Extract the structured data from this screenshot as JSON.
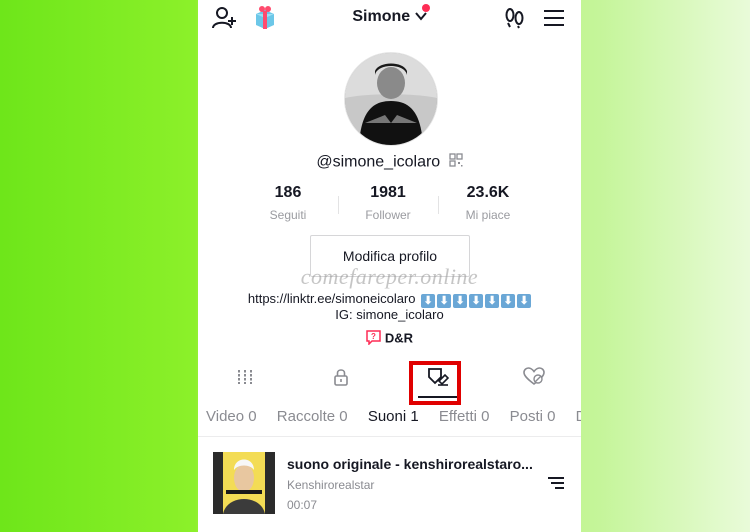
{
  "header": {
    "title": "Simone",
    "icons": [
      "add-user-icon",
      "gift-icon",
      "footprints-icon",
      "menu-icon"
    ],
    "notification_color": "#fe2c55"
  },
  "profile": {
    "username": "@simone_icolaro",
    "stats": [
      {
        "value": "186",
        "label": "Seguiti"
      },
      {
        "value": "1981",
        "label": "Follower"
      },
      {
        "value": "23.6K",
        "label": "Mi piace"
      }
    ],
    "edit_label": "Modifica profilo",
    "bio_link": "https://linktr.ee/simoneicolaro",
    "bio_arrows": [
      "⬇",
      "⬇",
      "⬇",
      "⬇",
      "⬇",
      "⬇",
      "⬇"
    ],
    "bio_ig": "IG: simone_icolaro",
    "qa_label": "D&R"
  },
  "watermark": "comefareper.online",
  "icon_tabs": [
    "grid-icon",
    "lock-icon",
    "bookmark-icon",
    "liked-icon"
  ],
  "sub_tabs": [
    {
      "label": "Video 0",
      "active": false
    },
    {
      "label": "Raccolte 0",
      "active": false
    },
    {
      "label": "Suoni 1",
      "active": true
    },
    {
      "label": "Effetti 0",
      "active": false
    },
    {
      "label": "Posti 0",
      "active": false
    },
    {
      "label": "D",
      "active": false
    }
  ],
  "sound": {
    "title": "suono originale - kenshirorealstaro...",
    "author": "Kenshirorealstar",
    "duration": "00:07"
  },
  "colors": {
    "accent": "#fe2c55",
    "highlight": "#e00000",
    "text": "#161823",
    "muted": "#8a8b91"
  }
}
